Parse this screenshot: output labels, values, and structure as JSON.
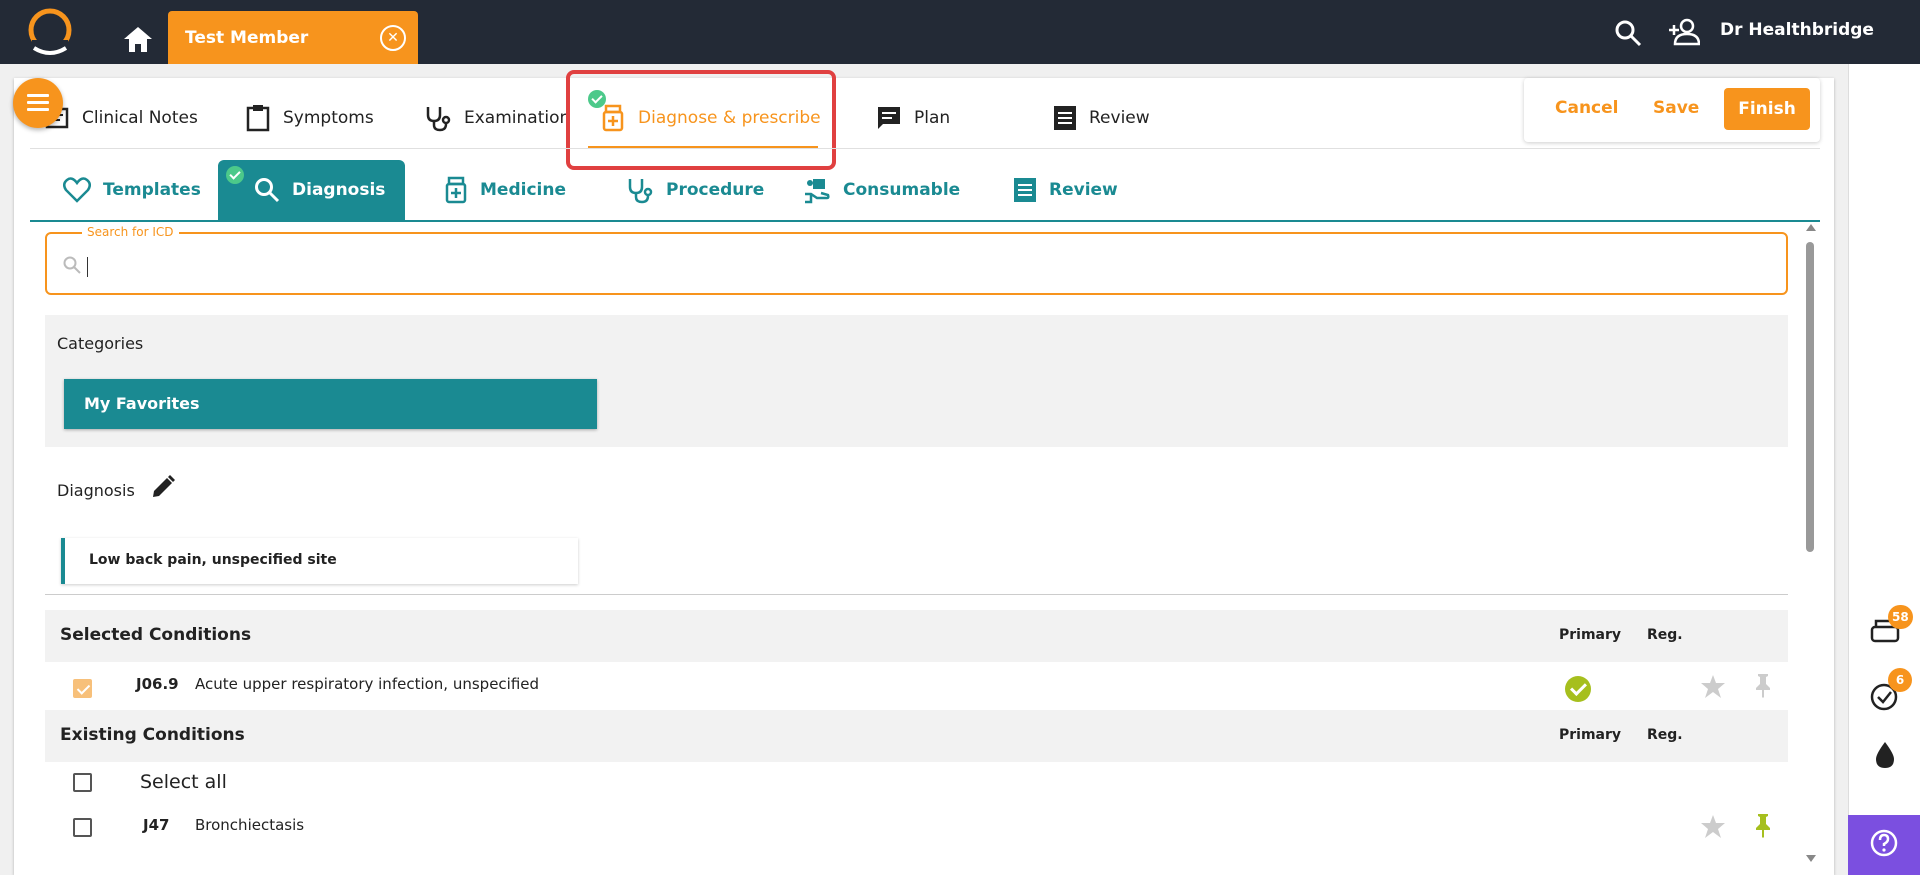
{
  "header": {
    "member_tab_label": "Test Member",
    "doctor_name": "Dr Healthbridge"
  },
  "main_tabs": [
    {
      "label": "Clinical Notes",
      "icon": "notes-icon"
    },
    {
      "label": "Symptoms",
      "icon": "clipboard-icon"
    },
    {
      "label": "Examination",
      "icon": "stethoscope-icon"
    },
    {
      "label": "Diagnose & prescribe",
      "icon": "medicine-bottle-icon",
      "active": true,
      "completed": true
    },
    {
      "label": "Plan",
      "icon": "chat-icon"
    },
    {
      "label": "Review",
      "icon": "list-icon"
    }
  ],
  "actions": {
    "cancel": "Cancel",
    "save": "Save",
    "finish": "Finish"
  },
  "sub_tabs": [
    {
      "label": "Templates",
      "icon": "heart-icon"
    },
    {
      "label": "Diagnosis",
      "icon": "search-icon",
      "active": true,
      "completed": true
    },
    {
      "label": "Medicine",
      "icon": "medicine-bottle-icon"
    },
    {
      "label": "Procedure",
      "icon": "stethoscope-icon"
    },
    {
      "label": "Consumable",
      "icon": "hand-icon"
    },
    {
      "label": "Review",
      "icon": "list-icon"
    }
  ],
  "search": {
    "label": "Search for ICD",
    "value": ""
  },
  "categories": {
    "label": "Categories",
    "favorites_label": "My Favorites"
  },
  "diagnosis": {
    "label": "Diagnosis",
    "chip": "Low back pain, unspecified site"
  },
  "selected_conditions": {
    "title": "Selected Conditions",
    "col_primary": "Primary",
    "col_reg": "Reg.",
    "rows": [
      {
        "code": "J06.9",
        "description": "Acute upper respiratory infection, unspecified",
        "checked": true,
        "primary": true,
        "favorite": false,
        "pinned": false
      }
    ]
  },
  "existing_conditions": {
    "title": "Existing Conditions",
    "col_primary": "Primary",
    "col_reg": "Reg.",
    "select_all": "Select all",
    "rows": [
      {
        "code": "J47",
        "description": "Bronchiectasis",
        "checked": false,
        "favorite": false,
        "pinned": true
      }
    ]
  },
  "side_badges": {
    "queue": "58",
    "tasks": "6"
  },
  "colors": {
    "accent": "#f7941d",
    "teal": "#1a8a92",
    "topbar": "#232a36",
    "primary_green": "#a6bf1e",
    "help": "#7b4fe0"
  }
}
